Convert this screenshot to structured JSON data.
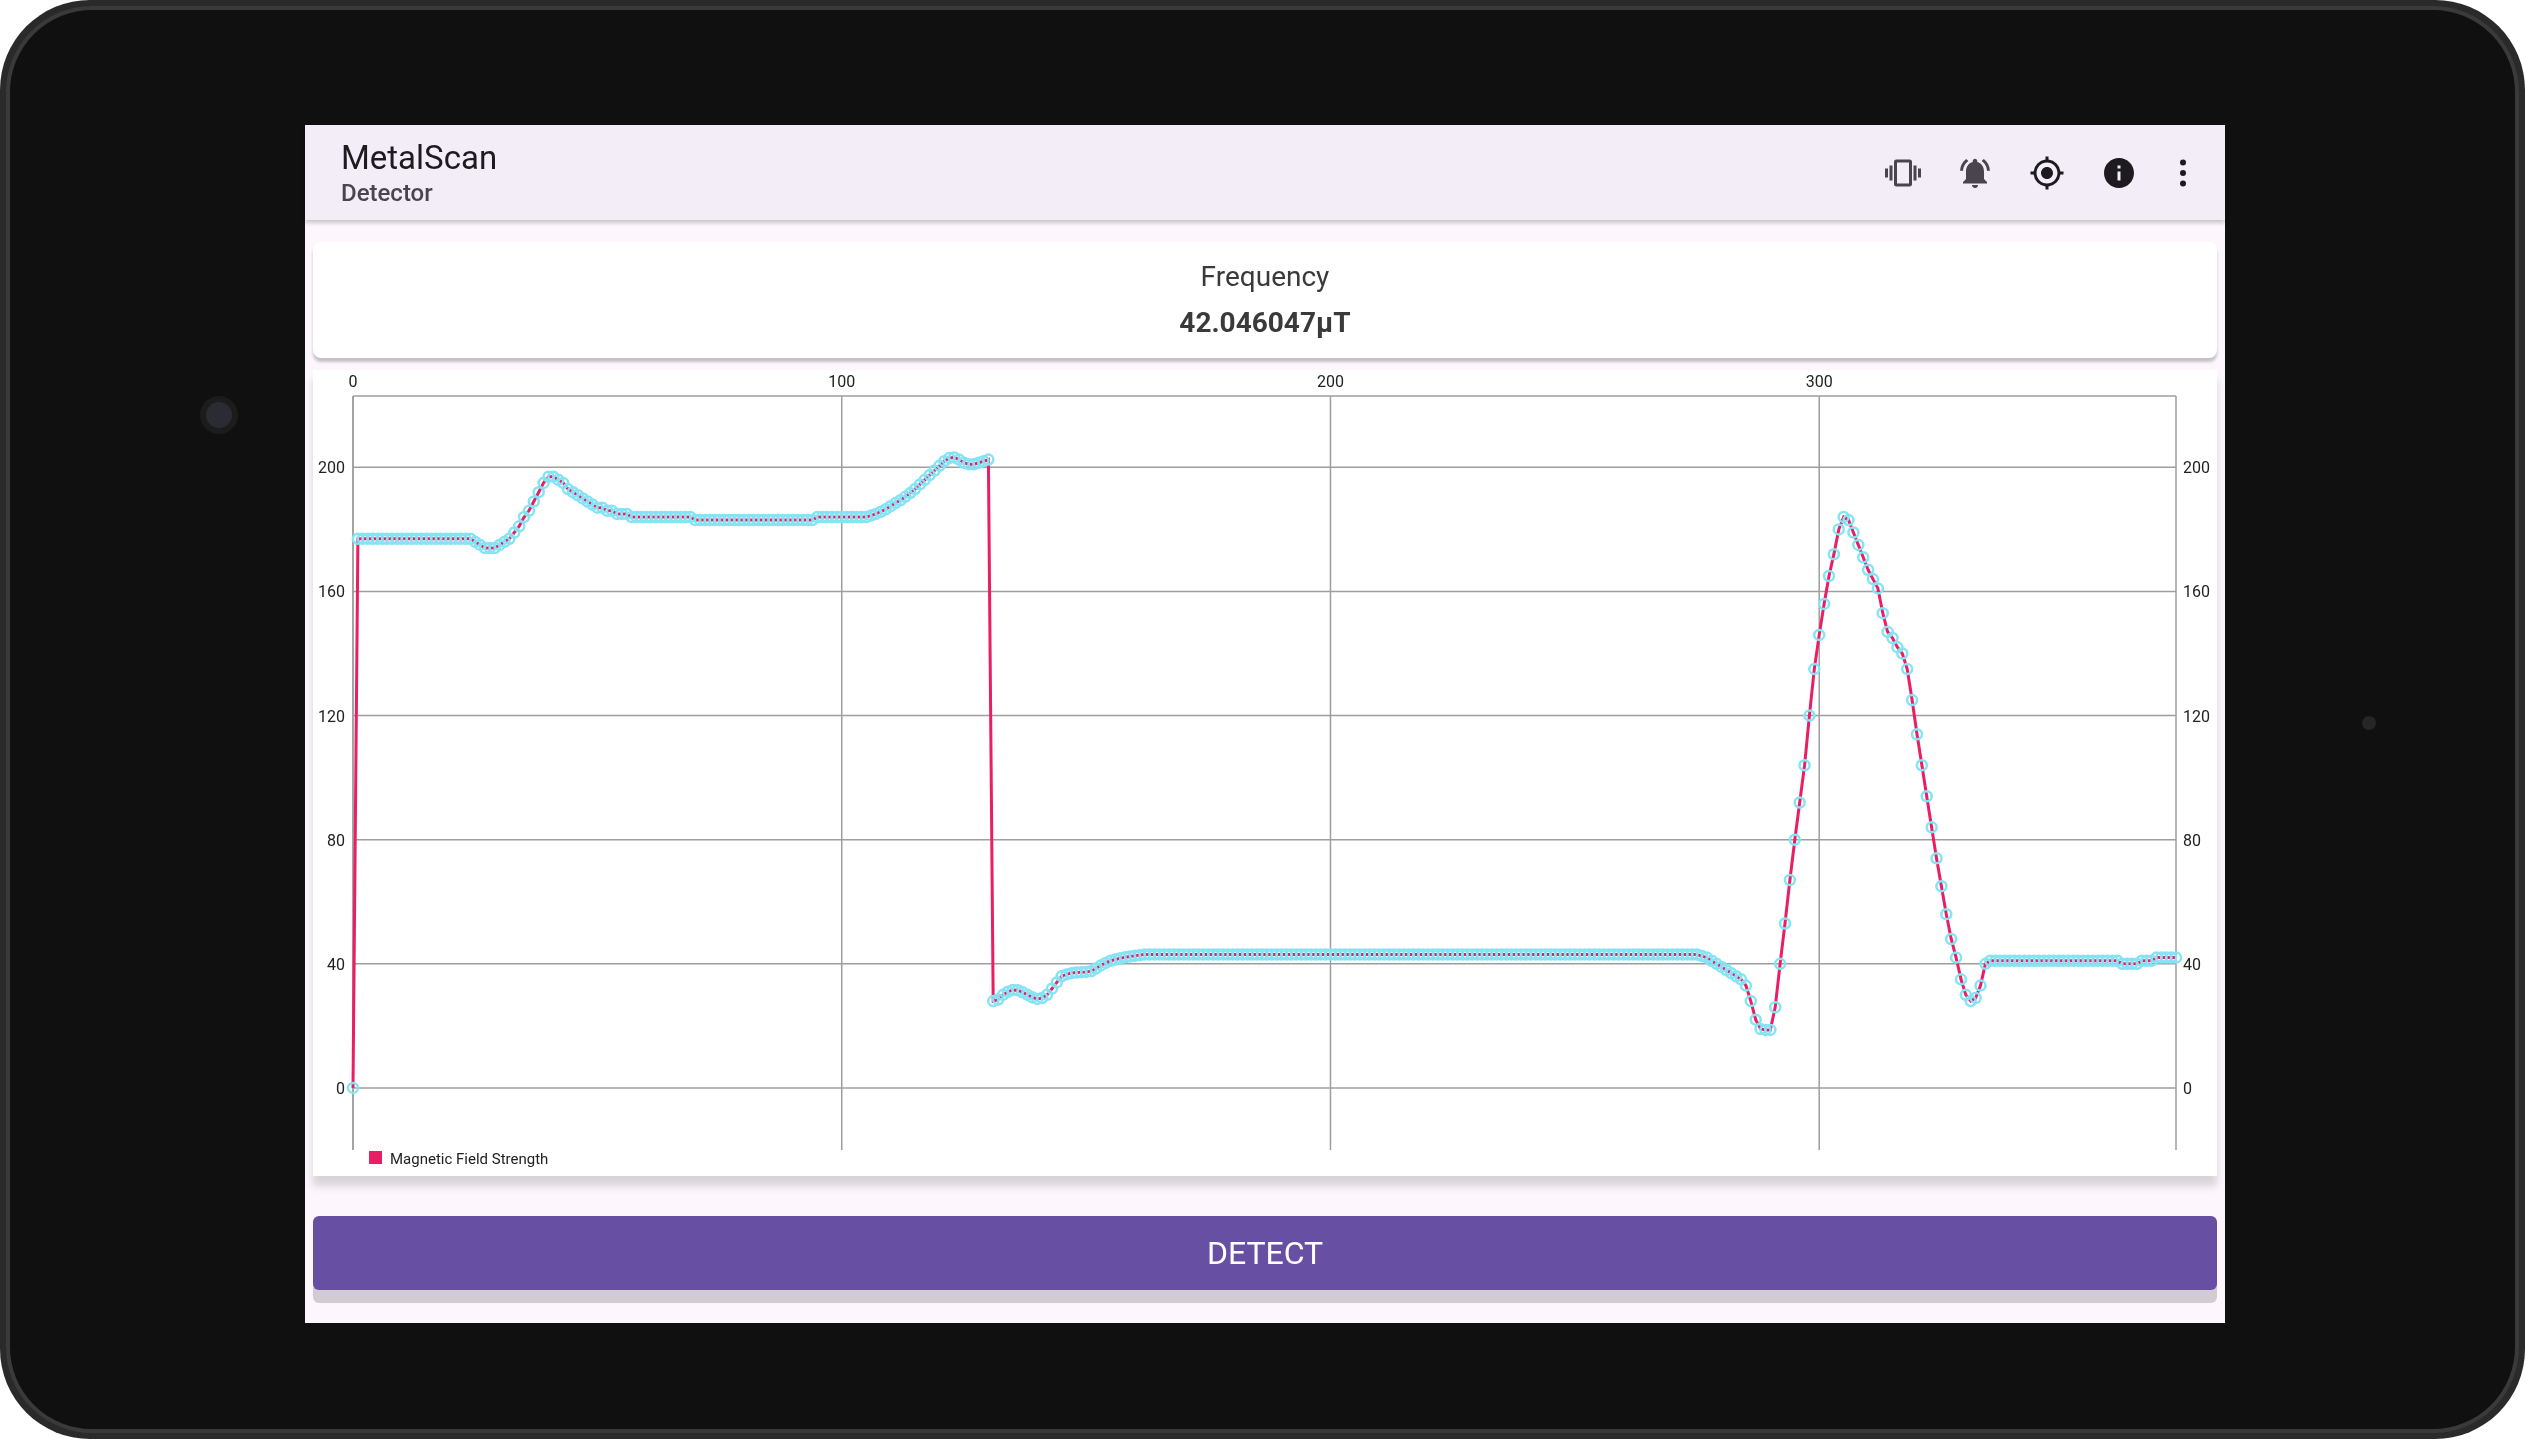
{
  "app_bar": {
    "title": "MetalScan",
    "subtitle": "Detector"
  },
  "frequency_card": {
    "label": "Frequency",
    "value": "42.046047μT"
  },
  "chart": {
    "left_axis_labels": [
      "200",
      "160",
      "120",
      "80",
      "40",
      "0"
    ],
    "right_axis_labels": [
      "200",
      "160",
      "120",
      "80",
      "40",
      "0"
    ],
    "chart_data": {
      "type": "line",
      "grid": true,
      "xlim": [
        0,
        373
      ],
      "ylim": [
        -20,
        223
      ],
      "xticks": [
        0,
        100,
        200,
        300
      ],
      "yticks": [
        0,
        40,
        80,
        120,
        160,
        200
      ],
      "x": [
        0,
        1,
        2,
        3,
        4,
        5,
        6,
        7,
        8,
        9,
        10,
        11,
        12,
        13,
        14,
        15,
        16,
        17,
        18,
        19,
        20,
        21,
        22,
        23,
        24,
        25,
        26,
        27,
        28,
        29,
        30,
        31,
        32,
        33,
        34,
        35,
        36,
        37,
        38,
        39,
        40,
        41,
        42,
        43,
        44,
        45,
        46,
        47,
        48,
        49,
        50,
        51,
        52,
        53,
        54,
        55,
        56,
        57,
        58,
        59,
        60,
        61,
        62,
        63,
        64,
        65,
        66,
        67,
        68,
        69,
        70,
        71,
        72,
        73,
        74,
        75,
        76,
        77,
        78,
        79,
        80,
        81,
        82,
        83,
        84,
        85,
        86,
        87,
        88,
        89,
        90,
        91,
        92,
        93,
        94,
        95,
        96,
        97,
        98,
        99,
        100,
        101,
        102,
        103,
        104,
        105,
        106,
        107,
        108,
        109,
        110,
        111,
        112,
        113,
        114,
        115,
        116,
        117,
        118,
        119,
        120,
        121,
        122,
        123,
        124,
        125,
        126,
        127,
        128,
        129,
        130,
        131,
        132,
        133,
        134,
        135,
        136,
        137,
        138,
        139,
        140,
        141,
        142,
        143,
        144,
        145,
        146,
        147,
        148,
        149,
        150,
        151,
        152,
        153,
        154,
        155,
        156,
        157,
        158,
        159,
        160,
        161,
        162,
        163,
        164,
        165,
        166,
        167,
        168,
        169,
        170,
        171,
        172,
        173,
        174,
        175,
        176,
        177,
        178,
        179,
        180,
        181,
        182,
        183,
        184,
        185,
        186,
        187,
        188,
        189,
        190,
        191,
        192,
        193,
        194,
        195,
        196,
        197,
        198,
        199,
        200,
        201,
        202,
        203,
        204,
        205,
        206,
        207,
        208,
        209,
        210,
        211,
        212,
        213,
        214,
        215,
        216,
        217,
        218,
        219,
        220,
        221,
        222,
        223,
        224,
        225,
        226,
        227,
        228,
        229,
        230,
        231,
        232,
        233,
        234,
        235,
        236,
        237,
        238,
        239,
        240,
        241,
        242,
        243,
        244,
        245,
        246,
        247,
        248,
        249,
        250,
        251,
        252,
        253,
        254,
        255,
        256,
        257,
        258,
        259,
        260,
        261,
        262,
        263,
        264,
        265,
        266,
        267,
        268,
        269,
        270,
        271,
        272,
        273,
        274,
        275,
        276,
        277,
        278,
        279,
        280,
        281,
        282,
        283,
        284,
        285,
        286,
        287,
        288,
        289,
        290,
        291,
        292,
        293,
        294,
        295,
        296,
        297,
        298,
        299,
        300,
        301,
        302,
        303,
        304,
        305,
        306,
        307,
        308,
        309,
        310,
        311,
        312,
        313,
        314,
        315,
        316,
        317,
        318,
        319,
        320,
        321,
        322,
        323,
        324,
        325,
        326,
        327,
        328,
        329,
        330,
        331,
        332,
        333,
        334,
        335,
        336,
        337,
        338,
        339,
        340,
        341,
        342,
        343,
        344,
        345,
        346,
        347,
        348,
        349,
        350,
        351,
        352,
        353,
        354,
        355,
        356,
        357,
        358,
        359,
        360,
        361,
        362,
        363,
        364,
        365,
        366,
        367,
        368,
        369,
        370,
        371,
        372,
        373
      ],
      "series": [
        {
          "name": "Magnetic Field Strength",
          "color": "#e91e63",
          "marker": "o",
          "values": [
            0,
            177,
            177,
            177,
            177,
            177,
            177,
            177,
            177,
            177,
            177,
            177,
            177,
            177,
            177,
            177,
            177,
            177,
            177,
            177,
            177,
            177,
            177,
            177,
            177,
            176,
            175,
            174,
            174,
            174,
            175,
            176,
            177,
            179,
            181,
            184,
            186,
            189,
            192,
            195,
            197,
            197,
            196,
            195,
            193,
            192,
            191,
            190,
            189,
            188,
            187,
            187,
            186,
            186,
            185,
            185,
            185,
            184,
            184,
            184,
            184,
            184,
            184,
            184,
            184,
            184,
            184,
            184,
            184,
            184,
            183,
            183,
            183,
            183,
            183,
            183,
            183,
            183,
            183,
            183,
            183,
            183,
            183,
            183,
            183,
            183,
            183,
            183,
            183,
            183,
            183,
            183,
            183,
            183,
            183,
            184,
            184,
            184,
            184,
            184,
            184,
            184,
            184,
            184,
            184,
            184,
            184.5,
            185,
            185.7,
            186.5,
            187.5,
            188.5,
            189.4,
            190.5,
            191.7,
            193,
            194.5,
            196,
            197.5,
            199,
            200.5,
            202,
            203,
            203.2,
            202.5,
            201.5,
            201,
            201,
            201.5,
            202,
            202.5,
            28,
            28.5,
            30,
            31,
            31.6,
            31.5,
            30.8,
            30,
            29.2,
            28.7,
            29,
            30,
            32,
            34,
            36,
            36.6,
            37,
            37.2,
            37.3,
            37.4,
            37.6,
            38.5,
            39.5,
            40.3,
            41,
            41.4,
            41.8,
            42.1,
            42.4,
            42.6,
            42.8,
            43,
            43,
            43,
            43,
            43,
            43,
            43,
            43,
            43,
            43,
            43,
            43,
            43,
            43,
            43,
            43,
            43,
            43,
            43,
            43,
            43,
            43,
            43,
            43,
            43,
            43,
            43,
            43,
            43,
            43,
            43,
            43,
            43,
            43,
            43,
            43,
            43,
            43,
            43,
            43,
            43,
            43,
            43,
            43,
            43,
            43,
            43,
            43,
            43,
            43,
            43,
            43,
            43,
            43,
            43,
            43,
            43,
            43,
            43,
            43,
            43,
            43,
            43,
            43,
            43,
            43,
            43,
            43,
            43,
            43,
            43,
            43,
            43,
            43,
            43,
            43,
            43,
            43,
            43,
            43,
            43,
            43,
            43,
            43,
            43,
            43,
            43,
            43,
            43,
            43,
            43,
            43,
            43,
            43,
            43,
            43,
            43,
            43,
            43,
            43,
            43,
            43,
            43,
            43,
            43,
            43,
            43,
            43,
            43,
            43,
            43,
            43,
            43,
            43,
            42.5,
            42,
            41,
            40,
            39,
            38,
            37,
            36,
            35,
            33,
            28,
            22,
            19,
            18.7,
            18.7,
            26,
            40,
            53,
            67,
            80,
            92,
            104,
            120,
            135,
            146,
            156,
            165,
            172,
            180,
            184,
            183,
            179,
            175,
            171,
            167,
            164,
            161,
            153,
            147,
            145,
            142,
            140,
            135,
            125,
            114,
            104,
            94,
            84,
            74,
            65,
            56,
            48,
            42,
            35,
            30,
            28,
            29,
            33,
            40,
            41,
            41,
            41,
            41,
            41,
            41,
            41,
            41,
            41,
            41,
            41,
            41,
            41,
            41,
            41,
            41,
            41,
            41,
            41,
            41,
            41,
            41,
            41,
            41,
            41,
            41,
            41,
            40,
            40,
            40,
            40,
            41,
            41,
            41,
            42,
            42,
            42,
            42,
            42
          ]
        }
      ]
    }
  },
  "detect_button": {
    "label": "DETECT"
  }
}
